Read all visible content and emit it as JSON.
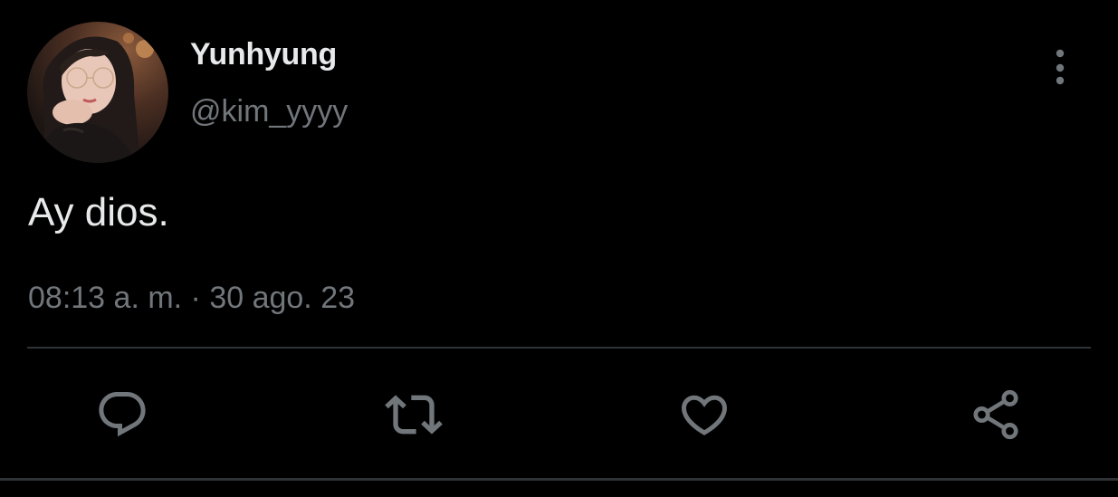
{
  "author": {
    "display_name": "Yunhyung",
    "handle": "@kim_yyyy"
  },
  "tweet": {
    "text": "Ay dios.",
    "timestamp": "08:13 a. m. · 30 ago. 23"
  },
  "icons": {
    "more": "more-vertical-icon",
    "reply": "reply-icon",
    "retweet": "retweet-icon",
    "like": "heart-icon",
    "share": "share-icon"
  },
  "colors": {
    "background": "#000000",
    "primary_text": "#e7e9ea",
    "secondary_text": "#71767b",
    "divider": "#2f3336"
  }
}
